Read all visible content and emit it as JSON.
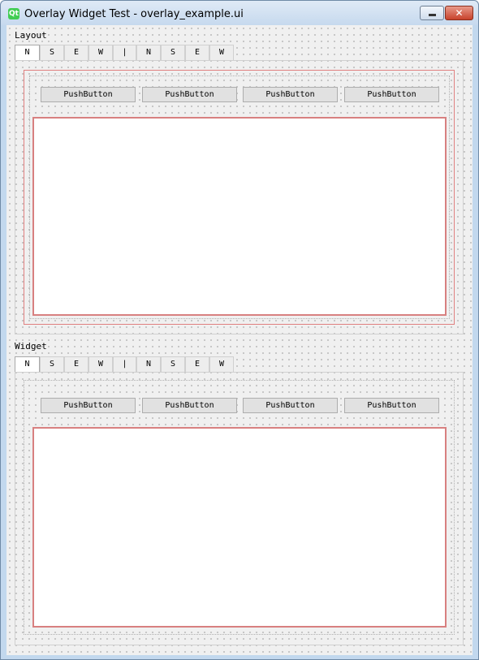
{
  "window": {
    "title": "Overlay Widget Test - overlay_example.ui",
    "icon_text": "Qt",
    "minimize_icon": "minimize-icon",
    "close_icon": "close-icon",
    "close_glyph": "✕"
  },
  "colors": {
    "overlay_border": "#e08080",
    "button_bg": "#e1e1e1",
    "client_bg": "#f0f0f0"
  },
  "sections": [
    {
      "label": "Layout",
      "tabs": [
        "N",
        "S",
        "E",
        "W",
        "|",
        "N",
        "S",
        "E",
        "W"
      ],
      "active_tab": "N",
      "buttons": [
        "PushButton",
        "PushButton",
        "PushButton",
        "PushButton"
      ],
      "text_value": ""
    },
    {
      "label": "Widget",
      "tabs": [
        "N",
        "S",
        "E",
        "W",
        "|",
        "N",
        "S",
        "E",
        "W"
      ],
      "active_tab": "N",
      "buttons": [
        "PushButton",
        "PushButton",
        "PushButton",
        "PushButton"
      ],
      "text_value": ""
    }
  ]
}
